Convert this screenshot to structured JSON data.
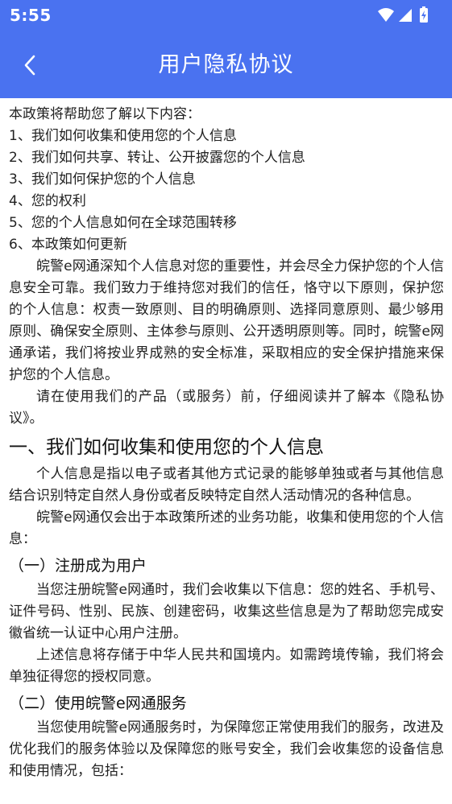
{
  "status_bar": {
    "time": "5:55",
    "icons": [
      "wifi-icon",
      "signal-icon",
      "battery-charging-icon"
    ]
  },
  "app_bar": {
    "title": "用户隐私协议",
    "back_icon": "chevron-left-icon",
    "background": "#4a72f0"
  },
  "content": {
    "intro": "本政策将帮助您了解以下内容：",
    "toc": [
      "1、我们如何收集和使用您的个人信息",
      "2、我们如何共享、转让、公开披露您的个人信息",
      "3、我们如何保护您的个人信息",
      "4、您的权利",
      "5、您的个人信息如何在全球范围转移",
      "6、本政策如何更新"
    ],
    "para1": "皖警e网通深知个人信息对您的重要性，并会尽全力保护您的个人信息安全可靠。我们致力于维持您对我们的信任，恪守以下原则，保护您的个人信息：权责一致原则、目的明确原则、选择同意原则、最少够用原则、确保安全原则、主体参与原则、公开透明原则等。同时，皖警e网通承诺，我们将按业界成熟的安全标准，采取相应的安全保护措施来保护您的个人信息。",
    "para2": "请在使用我们的产品（或服务）前，仔细阅读并了解本《隐私协议》。",
    "section1_title": "一、我们如何收集和使用您的个人信息",
    "section1_para1": "个人信息是指以电子或者其他方式记录的能够单独或者与其他信息结合识别特定自然人身份或者反映特定自然人活动情况的各种信息。",
    "section1_para2": "皖警e网通仅会出于本政策所述的业务功能，收集和使用您的个人信息：",
    "sub1_title": "（一）注册成为用户",
    "sub1_para1": "当您注册皖警e网通时，我们会收集以下信息：您的姓名、手机号、证件号码、性别、民族、创建密码，收集这些信息是为了帮助您完成安徽省统一认证中心用户注册。",
    "sub1_para2": "上述信息将存储于中华人民共和国境内。如需跨境传输，我们将会单独征得您的授权同意。",
    "sub2_title": "（二）使用皖警e网通服务",
    "sub2_para1": "当您使用皖警e网通服务时，为保障您正常使用我们的服务，改进及优化我们的服务体验以及保障您的账号安全，我们会收集您的设备信息和使用情况，包括："
  }
}
